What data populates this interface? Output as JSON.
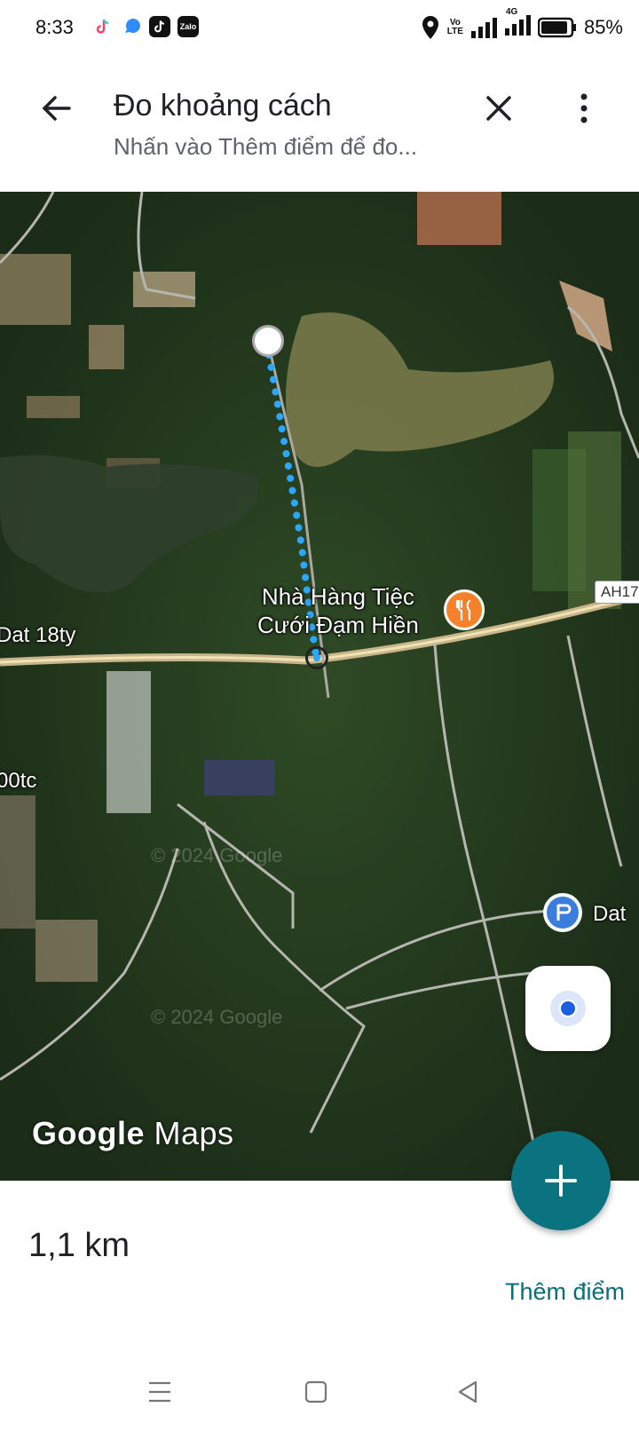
{
  "status_bar": {
    "time": "8:33",
    "battery": "85%",
    "network": "4G",
    "volte": "Vo\nLTE",
    "apps": [
      "tiktok-lite-icon",
      "messenger-icon",
      "tiktok-icon",
      "zalo-icon"
    ],
    "zalo_label": "Zalo"
  },
  "header": {
    "title": "Đo khoảng cách",
    "subtitle": "Nhấn vào Thêm điểm để đo..."
  },
  "map": {
    "poi_name_line1": "Nhà Hàng Tiệc",
    "poi_name_line2": "Cưới Đạm Hiền",
    "road_shield": "AH17",
    "label_left": "Dat 18ty",
    "label_left2": "00tc",
    "label_right": "Dat",
    "brand_google": "Google",
    "brand_maps": "Maps",
    "watermark": "© 2024 Google"
  },
  "bottom": {
    "distance": "1,1 km",
    "add_point": "Thêm điểm"
  },
  "colors": {
    "accent": "#0b7280",
    "measure_line": "#2aa7ff",
    "poi": "#f5822a"
  }
}
